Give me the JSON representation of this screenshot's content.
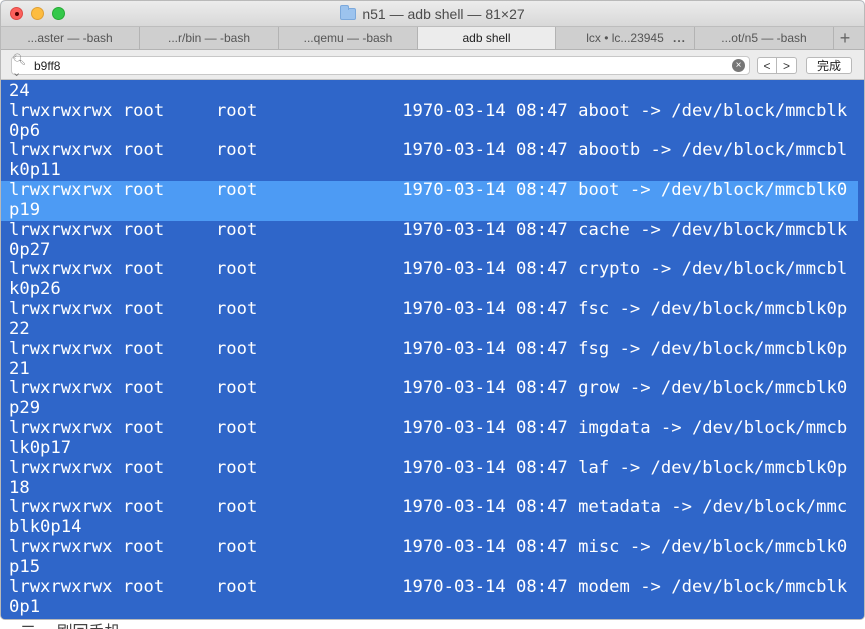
{
  "window": {
    "title": "n51 — adb shell — 81×27"
  },
  "tabs": [
    {
      "label": "...aster — -bash"
    },
    {
      "label": "...r/bin — -bash"
    },
    {
      "label": "...qemu — -bash"
    },
    {
      "label": "adb shell"
    },
    {
      "label": "lcx • lc...23945"
    },
    {
      "label": "...ot/n5 — -bash"
    }
  ],
  "tab_more": "...",
  "tab_add": "+",
  "find": {
    "query": "b9ff8",
    "prev_label": "<",
    "next_label": ">",
    "done_label": "完成"
  },
  "terminal": {
    "lines": [
      "24",
      "lrwxrwxrwx root     root              1970-03-14 08:47 aboot -> /dev/block/mmcblk",
      "0p6",
      "lrwxrwxrwx root     root              1970-03-14 08:47 abootb -> /dev/block/mmcbl",
      "k0p11",
      "lrwxrwxrwx root     root              1970-03-14 08:47 boot -> /dev/block/mmcblk0",
      "p19",
      "lrwxrwxrwx root     root              1970-03-14 08:47 cache -> /dev/block/mmcblk",
      "0p27",
      "lrwxrwxrwx root     root              1970-03-14 08:47 crypto -> /dev/block/mmcbl",
      "k0p26",
      "lrwxrwxrwx root     root              1970-03-14 08:47 fsc -> /dev/block/mmcblk0p",
      "22",
      "lrwxrwxrwx root     root              1970-03-14 08:47 fsg -> /dev/block/mmcblk0p",
      "21",
      "lrwxrwxrwx root     root              1970-03-14 08:47 grow -> /dev/block/mmcblk0",
      "p29",
      "lrwxrwxrwx root     root              1970-03-14 08:47 imgdata -> /dev/block/mmcb",
      "lk0p17",
      "lrwxrwxrwx root     root              1970-03-14 08:47 laf -> /dev/block/mmcblk0p",
      "18",
      "lrwxrwxrwx root     root              1970-03-14 08:47 metadata -> /dev/block/mmc",
      "blk0p14",
      "lrwxrwxrwx root     root              1970-03-14 08:47 misc -> /dev/block/mmcblk0",
      "p15",
      "lrwxrwxrwx root     root              1970-03-14 08:47 modem -> /dev/block/mmcblk",
      "0p1"
    ]
  },
  "background_text": "二、 刷回手机"
}
